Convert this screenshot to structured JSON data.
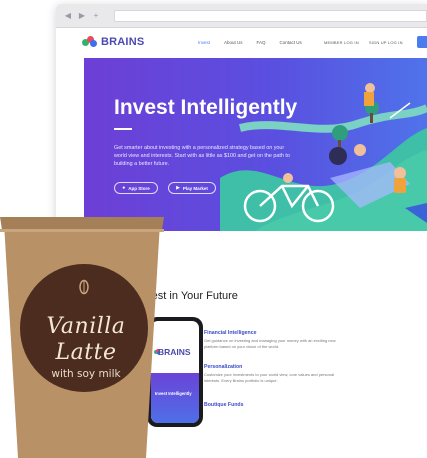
{
  "browser": {
    "back": "◀",
    "forward": "▶",
    "reload": "+"
  },
  "site": {
    "logo": "BRAINS",
    "nav": [
      "Invest",
      "About Us",
      "FAQ",
      "Contact Us"
    ],
    "nav_right": [
      "MEMBER LOG IN",
      "SIGN UP LOG IN"
    ]
  },
  "hero": {
    "title": "Invest Intelligently",
    "description": "Get smarter about investing with a personalized strategy based on your world view and interests. Start with as little as $100 and get on the path to building a better future.",
    "app_store": "App Store",
    "play_market": "Play Market"
  },
  "section": {
    "title": "Invest in Your Future",
    "features": [
      {
        "name": "Financial Intelligence",
        "desc": "Get guidance on investing and managing your money with an exciting new platform based on your vision of the world."
      },
      {
        "name": "Personalization",
        "desc": "Customize your investments to your world view, core values and personal interests. Every Brains portfolio is unique."
      },
      {
        "name": "Boutique Funds",
        "desc": ""
      }
    ]
  },
  "phone": {
    "logo": "BRAINS",
    "hero_text": "Invest Intelligently"
  },
  "cup": {
    "line1": "Vanilla",
    "line2": "Latte",
    "line3": "with soy milk"
  },
  "colors": {
    "brand": "#4a4ab0",
    "hero_start": "#6d3fd6",
    "hero_end": "#4f73ea",
    "cup": "#b99166",
    "label": "#4b2c1f"
  }
}
